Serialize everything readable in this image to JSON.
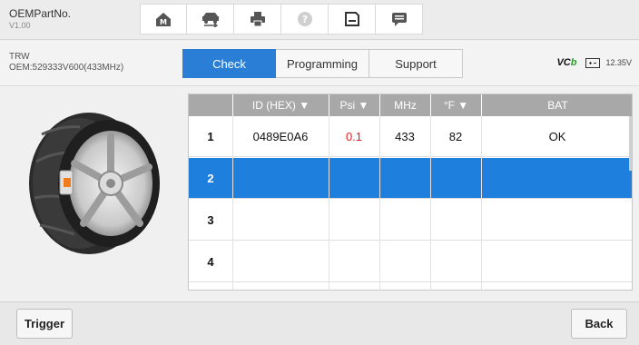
{
  "app": {
    "title": "OEMPartNo.",
    "version": "V1.00"
  },
  "toolbar": [
    {
      "icon": "home-icon"
    },
    {
      "icon": "vehicle-swap-icon"
    },
    {
      "icon": "print-icon"
    },
    {
      "icon": "help-icon"
    },
    {
      "icon": "save-icon"
    },
    {
      "icon": "message-icon"
    }
  ],
  "sensor": {
    "brand": "TRW",
    "oem": "OEM:529333V600(433MHz)"
  },
  "tabs": [
    "Check",
    "Programming",
    "Support"
  ],
  "active_tab": "Check",
  "status": {
    "vci_prefix": "VC",
    "vci_suffix": "b",
    "voltage": "12.35V"
  },
  "table": {
    "headers": [
      "",
      "ID (HEX) ▼",
      "Psi ▼",
      "MHz",
      "°F ▼",
      "BAT"
    ],
    "rows": [
      {
        "index": "1",
        "id": "0489E0A6",
        "psi": "0.1",
        "mhz": "433",
        "temp": "82",
        "bat": "OK"
      },
      {
        "index": "2",
        "id": "",
        "psi": "",
        "mhz": "",
        "temp": "",
        "bat": ""
      },
      {
        "index": "3",
        "id": "",
        "psi": "",
        "mhz": "",
        "temp": "",
        "bat": ""
      },
      {
        "index": "4",
        "id": "",
        "psi": "",
        "mhz": "",
        "temp": "",
        "bat": ""
      }
    ],
    "selected_row": "2"
  },
  "buttons": {
    "trigger": "Trigger",
    "back": "Back"
  },
  "colors": {
    "accent": "#1f7fdc",
    "alert": "#e02020"
  }
}
